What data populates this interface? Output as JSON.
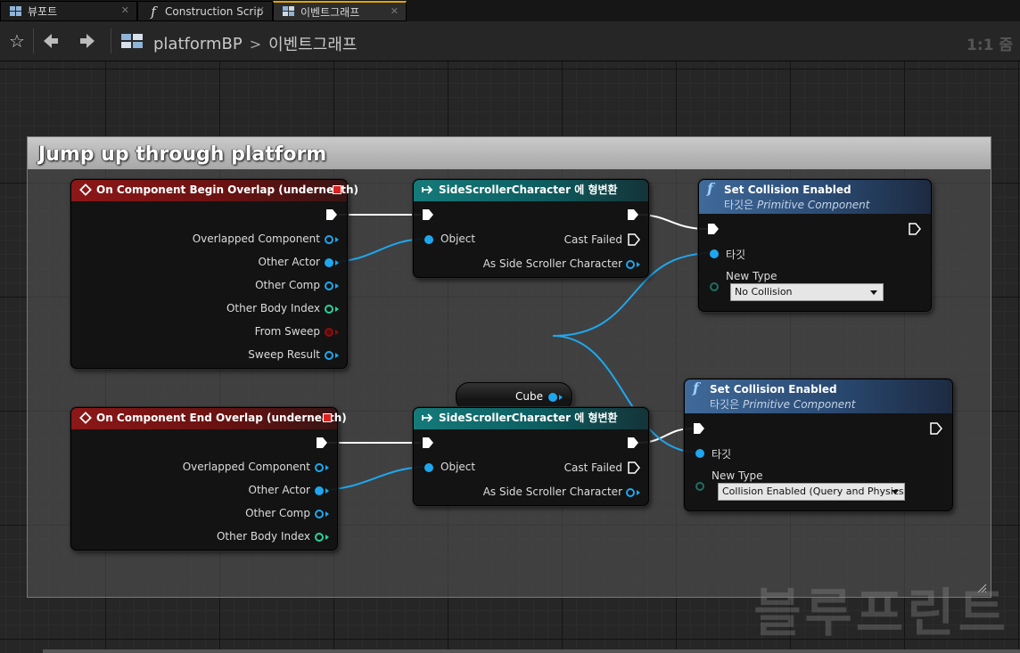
{
  "tabs": [
    {
      "label": "뷰포트",
      "icon": "viewport-icon"
    },
    {
      "label": "Construction Scrip",
      "icon": "function-icon"
    },
    {
      "label": "이벤트그래프",
      "icon": "event-graph-icon",
      "active": true
    }
  ],
  "toolbar": {
    "breadcrumb": [
      "platformBP",
      "이벤트그래프"
    ],
    "zoom": "1:1 줌"
  },
  "comment": {
    "title": "Jump up through platform"
  },
  "nodes": {
    "begin_overlap": {
      "title": "On Component Begin Overlap (underneath)",
      "pins": [
        "Overlapped Component",
        "Other Actor",
        "Other Comp",
        "Other Body Index",
        "From Sweep",
        "Sweep Result"
      ]
    },
    "cast1": {
      "title": "SideScrollerCharacter 에 형변환",
      "in_pin": "Object",
      "out_failed": "Cast Failed",
      "out_as": "As Side Scroller Character"
    },
    "set1": {
      "title": "Set Collision Enabled",
      "subtitle_prefix": "타깃은",
      "subtitle": "Primitive Component",
      "target": "타깃",
      "new_type_label": "New Type",
      "new_type_value": "No Collision"
    },
    "cube": {
      "label": "Cube"
    },
    "end_overlap": {
      "title": "On Component End Overlap (underneath)",
      "pins": [
        "Overlapped Component",
        "Other Actor",
        "Other Comp",
        "Other Body Index"
      ]
    },
    "cast2": {
      "title": "SideScrollerCharacter 에 형변환",
      "in_pin": "Object",
      "out_failed": "Cast Failed",
      "out_as": "As Side Scroller Character"
    },
    "set2": {
      "title": "Set Collision Enabled",
      "subtitle_prefix": "타깃은",
      "subtitle": "Primitive Component",
      "target": "타깃",
      "new_type_label": "New Type",
      "new_type_value": "Collision Enabled (Query and Physics)"
    }
  },
  "watermark": "블루프린트",
  "colors": {
    "object_pin": "#1ea7ee",
    "int_pin": "#28d3a0",
    "struct_pin": "#8a0f0f",
    "exec_wire": "#ffffff"
  }
}
